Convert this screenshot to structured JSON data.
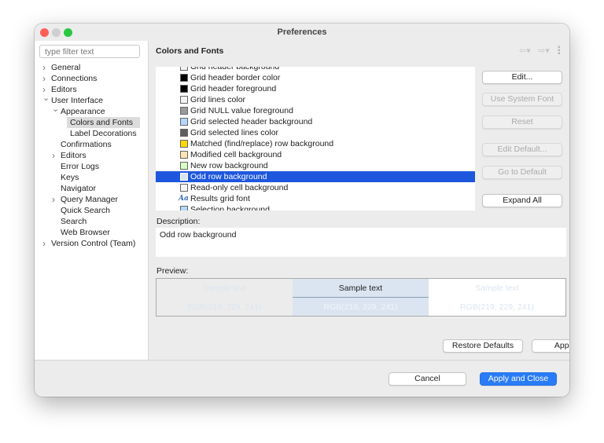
{
  "window": {
    "title": "Preferences"
  },
  "sidebar": {
    "filter_placeholder": "type filter text",
    "items": [
      {
        "label": "General",
        "level": 0,
        "chevron": true
      },
      {
        "label": "Connections",
        "level": 0,
        "chevron": true
      },
      {
        "label": "Editors",
        "level": 0,
        "chevron": true
      },
      {
        "label": "User Interface",
        "level": 0,
        "chevron": true,
        "expanded": true
      },
      {
        "label": "Appearance",
        "level": 1,
        "chevron": true,
        "expanded": true
      },
      {
        "label": "Colors and Fonts",
        "level": 2,
        "selected": true
      },
      {
        "label": "Label Decorations",
        "level": 2
      },
      {
        "label": "Confirmations",
        "level": 1
      },
      {
        "label": "Editors",
        "level": 1,
        "chevron": true
      },
      {
        "label": "Error Logs",
        "level": 1
      },
      {
        "label": "Keys",
        "level": 1
      },
      {
        "label": "Navigator",
        "level": 1
      },
      {
        "label": "Query Manager",
        "level": 1,
        "chevron": true
      },
      {
        "label": "Quick Search",
        "level": 1
      },
      {
        "label": "Search",
        "level": 1
      },
      {
        "label": "Web Browser",
        "level": 1
      },
      {
        "label": "Version Control (Team)",
        "level": 0,
        "chevron": true
      }
    ]
  },
  "main": {
    "title": "Colors and Fonts",
    "list": [
      {
        "label": "Grid header background",
        "color": "#f2f2f2"
      },
      {
        "label": "Grid header border color",
        "color": "#000000"
      },
      {
        "label": "Grid header foreground",
        "color": "#000000"
      },
      {
        "label": "Grid lines color",
        "color": "#f2f2f2"
      },
      {
        "label": "Grid NULL value foreground",
        "color": "#9a9a9a"
      },
      {
        "label": "Grid selected header background",
        "color": "#b5d8ff"
      },
      {
        "label": "Grid selected lines color",
        "color": "#5f5f5f"
      },
      {
        "label": "Matched (find/replace) row background",
        "color": "#ffd800"
      },
      {
        "label": "Modified cell background",
        "color": "#ffe3b3"
      },
      {
        "label": "New row background",
        "color": "#d8ffc4"
      },
      {
        "label": "Odd row background",
        "color": "#dbe5f1",
        "selected": true
      },
      {
        "label": "Read-only cell background",
        "color": "#f5f5f5"
      },
      {
        "label": "Results grid font",
        "font": true,
        "icon_text": "Aa"
      },
      {
        "label": "Selection background",
        "color": "#b5d8ff"
      }
    ],
    "buttons": {
      "edit": "Edit...",
      "use_system_font": "Use System Font",
      "reset": "Reset",
      "edit_default": "Edit Default...",
      "go_to_default": "Go to Default",
      "expand_all": "Expand All"
    },
    "description_label": "Description:",
    "description": "Odd row background",
    "preview_label": "Preview:",
    "preview": [
      {
        "sample": "Sample text",
        "rgb": "RGB(219, 229, 241)",
        "bg": "#ececec"
      },
      {
        "sample": "Sample text",
        "rgb": "RGB(219, 229, 241)",
        "bg": "#dbe5f1"
      },
      {
        "sample": "Sample text",
        "rgb": "RGB(219, 229, 241)",
        "bg": "#ffffff"
      }
    ],
    "restore_defaults": "Restore Defaults",
    "apply": "Apply"
  },
  "footer": {
    "cancel": "Cancel",
    "apply_and_close": "Apply and Close"
  },
  "colors": {
    "accent": "#2a7cf6",
    "selection": "#1e57de"
  }
}
